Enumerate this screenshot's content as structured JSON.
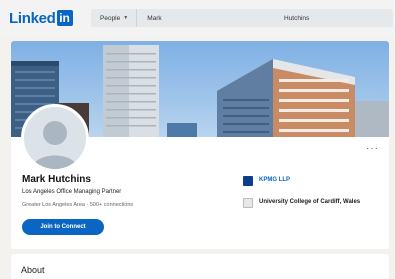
{
  "nav": {
    "logo_word": "Linked",
    "logo_in": "in",
    "search_filter": "People",
    "search_first_name": "Mark",
    "search_last_name": "Hutchins"
  },
  "profile": {
    "name": "Mark Hutchins",
    "headline": "Los Angeles Office Managing Partner",
    "location": "Greater Los Angeles Area · 500+ connections",
    "connect_label": "Join to Connect",
    "more_label": "···",
    "current_company": "KPMG LLP",
    "education": "University College of Cardiff, Wales"
  },
  "sections": {
    "about_title": "About"
  },
  "colors": {
    "brand_blue": "#0a66c2",
    "page_bg": "#f3f2ee",
    "kpmg_blue": "#0b3e8f"
  }
}
